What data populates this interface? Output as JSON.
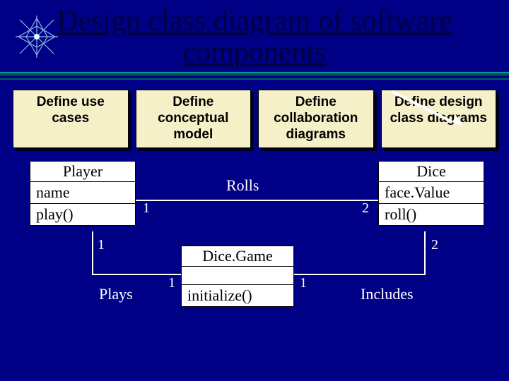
{
  "title_line1": "Design class diagram of software",
  "title_line2": "components",
  "process": {
    "b1": "Define use cases",
    "b2": "Define conceptual model",
    "b3": "Define collaboration diagrams",
    "b4": "Define design class diagrams"
  },
  "uml": {
    "player": {
      "name": "Player",
      "attr": "name",
      "op": "play()"
    },
    "dice": {
      "name": "Dice",
      "attr": "face.Value",
      "op": "roll()"
    },
    "game": {
      "name": "Dice.Game",
      "op": "initialize()"
    }
  },
  "assoc": {
    "rolls": {
      "label": "Rolls",
      "m1": "1",
      "m2": "2"
    },
    "plays": {
      "label": "Plays",
      "m1": "1",
      "m2": "1"
    },
    "includes": {
      "label": "Includes",
      "m1": "2",
      "m2": "1"
    }
  }
}
